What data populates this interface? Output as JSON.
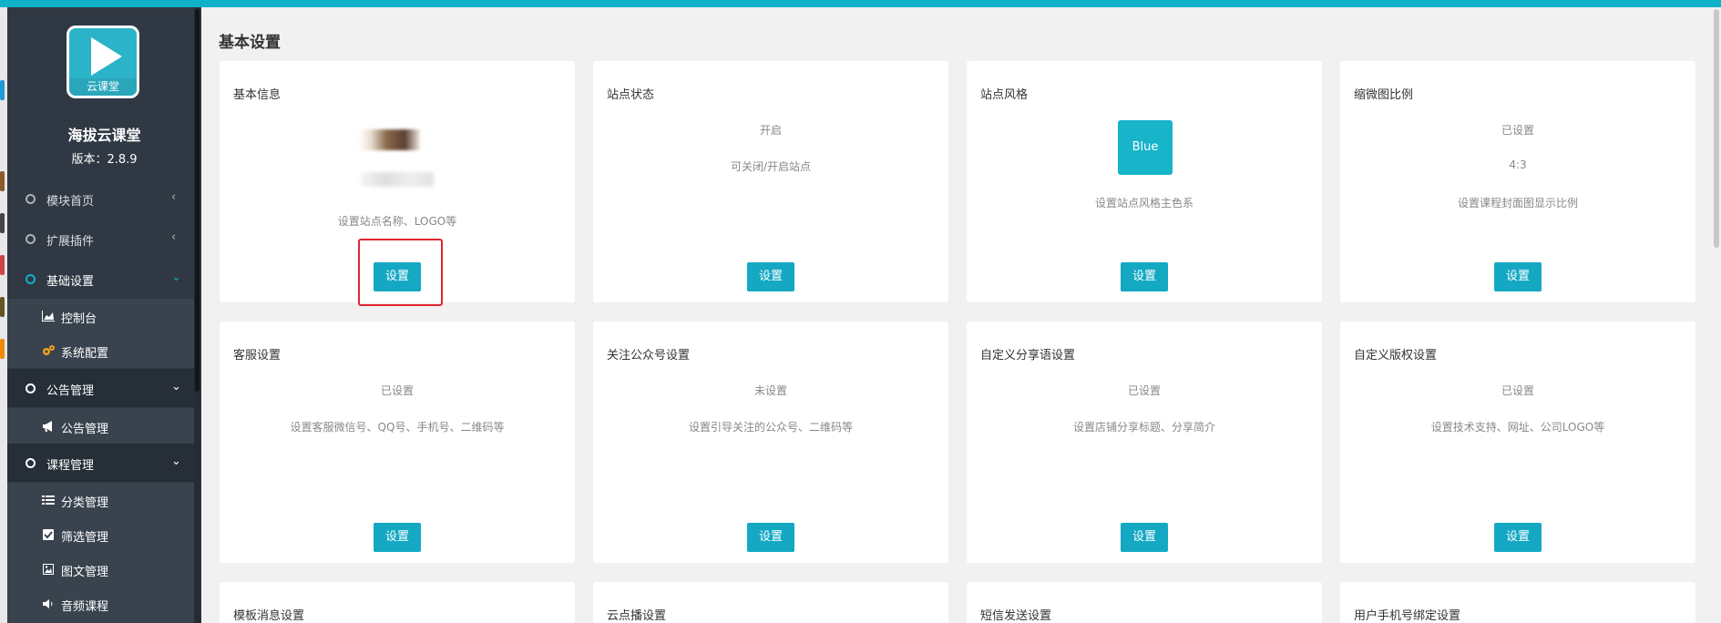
{
  "brand": {
    "logo_caption": "云课堂",
    "name": "海拔云课堂",
    "version": "版本：2.8.9"
  },
  "sidebar": {
    "modules_home": "模块首页",
    "extensions": "扩展插件",
    "basic_settings": "基础设置",
    "dashboard": "控制台",
    "system_config": "系统配置",
    "notice_group": "公告管理",
    "notice_manage": "公告管理",
    "course_group": "课程管理",
    "category": "分类管理",
    "filter": "筛选管理",
    "article": "图文管理",
    "audio": "音频课程",
    "arrow_left": "‹",
    "arrow_down": "⌄"
  },
  "page": {
    "title": "基本设置"
  },
  "cards": {
    "basic_info": {
      "title": "基本信息",
      "desc": "设置站点名称、LOGO等",
      "button": "设置"
    },
    "site_status": {
      "title": "站点状态",
      "status": "开启",
      "desc": "可关闭/开启站点",
      "button": "设置"
    },
    "site_style": {
      "title": "站点风格",
      "swatch": "Blue",
      "desc": "设置站点风格主色系",
      "button": "设置"
    },
    "thumb_ratio": {
      "title": "缩微图比例",
      "status": "已设置",
      "ratio": "4:3",
      "desc": "设置课程封面图显示比例",
      "button": "设置"
    },
    "customer_service": {
      "title": "客服设置",
      "status": "已设置",
      "desc": "设置客服微信号、QQ号、手机号、二维码等",
      "button": "设置"
    },
    "follow_official": {
      "title": "关注公众号设置",
      "status": "未设置",
      "desc": "设置引导关注的公众号、二维码等",
      "button": "设置"
    },
    "custom_share": {
      "title": "自定义分享语设置",
      "status": "已设置",
      "desc": "设置店铺分享标题、分享简介",
      "button": "设置"
    },
    "custom_copyright": {
      "title": "自定义版权设置",
      "status": "已设置",
      "desc": "设置技术支持、网址、公司LOGO等",
      "button": "设置"
    },
    "template_msg": {
      "title": "模板消息设置"
    },
    "vod": {
      "title": "云点播设置"
    },
    "sms": {
      "title": "短信发送设置"
    },
    "phone_bind": {
      "title": "用户手机号绑定设置"
    }
  },
  "colors": {
    "accent": "#14a8c3",
    "sidebar_bg": "#2f3843",
    "highlight": "#e0262c"
  }
}
